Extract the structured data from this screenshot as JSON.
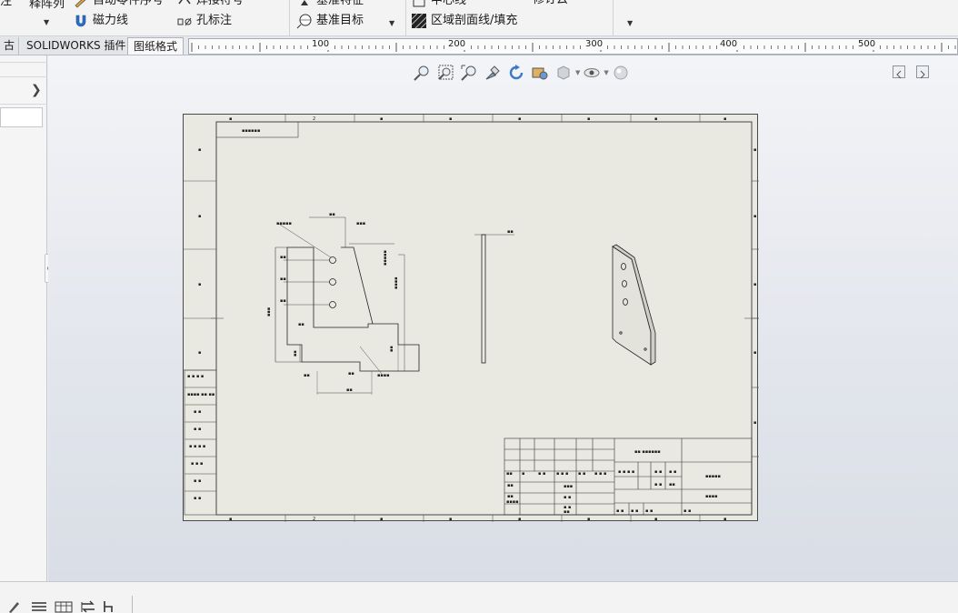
{
  "ribbon": {
    "items": {
      "cut_left_1": "注",
      "pattern": "释阵列",
      "auto_balloon": "自动零件序号",
      "magnetic_line": "磁力线",
      "weld_symbol": "焊接符号",
      "hole_callout": "孔标注",
      "datum_feature": "基准特征",
      "datum_target": "基准目标",
      "center_line": "中心线",
      "revision_cloud": "修订云",
      "area_hatch": "区域剖面线/填充"
    }
  },
  "tabs": {
    "cut_tab": "古",
    "addins": "SOLIDWORKS 插件",
    "sheet_format": "图纸格式"
  },
  "ruler": {
    "labels": [
      "100",
      "200",
      "300",
      "400",
      "500"
    ]
  },
  "colors": {
    "sheet": "#e9e9e2",
    "viewport_top": "#f3f4f7",
    "viewport_bottom": "#d9dde5",
    "ribbon": "#f3f3f3"
  },
  "icons": {
    "heads_up": [
      "zoom-to-fit-icon",
      "zoom-to-area-icon",
      "zoom-in-out-icon",
      "dynamic-annotation-icon",
      "redraw-icon",
      "scene-settings-icon",
      "display-style-icon",
      "hide-show-icon",
      "appearance-icon"
    ],
    "status": [
      "sketch-icon",
      "align-icon",
      "table-icon",
      "flip-icon",
      "units-icon"
    ]
  }
}
